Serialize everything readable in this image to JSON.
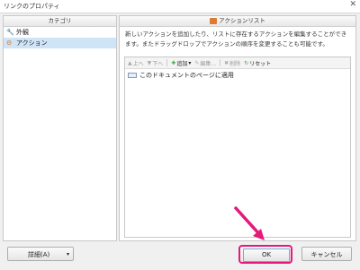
{
  "window": {
    "title": "リンクのプロパティ",
    "close_glyph": "✕"
  },
  "categories": {
    "header": "カテゴリ",
    "items": [
      {
        "label": "外観",
        "icon": "wrench-icon",
        "glyph": "🔧",
        "selected": false
      },
      {
        "label": "アクション",
        "icon": "action-gear-icon",
        "glyph": "⚙",
        "selected": true
      }
    ]
  },
  "actions": {
    "header": "アクションリスト",
    "description": "新しいアクションを追加したり、リストに存在するアクションを編集することができます。またドラッグドロップでアクションの順序を変更することも可能です。",
    "toolbar": {
      "up": "上へ",
      "down": "下へ",
      "add": "追加",
      "add_dropdown": "▾",
      "edit": "編集...",
      "delete": "削除",
      "reset": "リセット"
    },
    "list": [
      {
        "label": "このドキュメントのページに適用"
      }
    ]
  },
  "buttons": {
    "details": "詳細(A)",
    "details_dropdown": "▾",
    "ok": "OK",
    "cancel": "キャンセル"
  },
  "colors": {
    "highlight": "#e5197a",
    "selection": "#cfe4f7"
  }
}
